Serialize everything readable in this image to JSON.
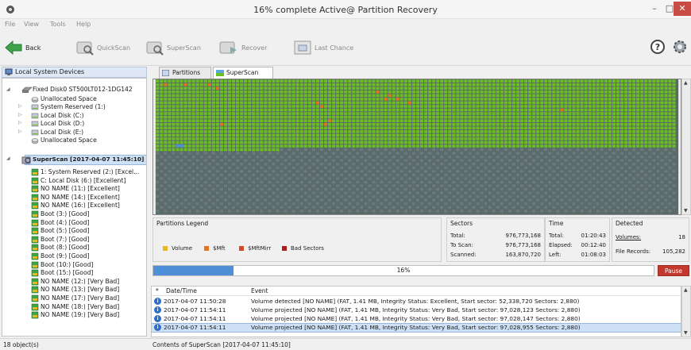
{
  "window": {
    "title": "16% complete Active@ Partition Recovery"
  },
  "menu": [
    "File",
    "View",
    "Tools",
    "Help"
  ],
  "toolbar": {
    "back": "Back",
    "quickscan": "QuickScan",
    "superscan": "SuperScan",
    "recover": "Recover",
    "last_chance": "Last Chance"
  },
  "left_panel": {
    "header": "Local System Devices",
    "disk": "Fixed Disk0 ST500LT012-1DG142",
    "disk_children": [
      "Unallocated Space",
      "System Reserved (1:)",
      "Local Disk (C:)",
      "Local Disk (D:)",
      "Local Disk (E:)",
      "Unallocated Space"
    ],
    "scan": "SuperScan [2017-04-07 11:45:10]",
    "scan_children": [
      "1: System Reserved (2:) [Excel...",
      "C: Local Disk (6:) [Excellent]",
      "NO NAME (11:) [Excellent]",
      "NO NAME (14:) [Excellent]",
      "NO NAME (16:) [Excellent]",
      "Boot (3:) [Good]",
      "Boot (4:) [Good]",
      "Boot (5:) [Good]",
      "Boot (7:) [Good]",
      "Boot (8:) [Good]",
      "Boot (9:) [Good]",
      "Boot (10:) [Good]",
      "Boot (15:) [Good]",
      "NO NAME (12:) [Very Bad]",
      "NO NAME (13:) [Very Bad]",
      "NO NAME (17:) [Very Bad]",
      "NO NAME (18:) [Very Bad]",
      "NO NAME (19:) [Very Bad]"
    ]
  },
  "tabs": [
    "Partitions [18]",
    "SuperScan [16%]"
  ],
  "legend": {
    "title": "Partitions Legend",
    "items": [
      {
        "label": "Volume",
        "color": "#e8b81c"
      },
      {
        "label": "$Mft",
        "color": "#e8731c"
      },
      {
        "label": "$MftMirr",
        "color": "#d24a2a"
      },
      {
        "label": "Bad Sectors",
        "color": "#b01c1c"
      }
    ]
  },
  "sectors": {
    "title": "Sectors",
    "total_label": "Total:",
    "total": "976,773,168",
    "toscan_label": "To Scan:",
    "toscan": "976,773,168",
    "scanned_label": "Scanned:",
    "scanned": "163,870,720"
  },
  "time": {
    "title": "Time",
    "total_label": "Total:",
    "total": "01:20:43",
    "elapsed_label": "Elapsed:",
    "elapsed": "00:12:40",
    "left_label": "Left:",
    "left": "01:08:03"
  },
  "detected": {
    "title": "Detected",
    "volumes_label": "Volumes:",
    "volumes": "18",
    "files_label": "File Records:",
    "files": "105,282"
  },
  "progress": {
    "percent_text": "16%",
    "fraction": 0.16
  },
  "pause": "Pause",
  "log": {
    "col_sort": "*",
    "col_date": "Date/Time",
    "col_event": "Event",
    "rows": [
      {
        "dt": "2017-04-07 11:50:28",
        "ev": "Volume detected [NO NAME] (FAT, 1.41 MB, Integrity Status: Excellent, Start sector: 52,338,720 Sectors: 2,880)"
      },
      {
        "dt": "2017-04-07 11:54:11",
        "ev": "Volume projected [NO NAME] (FAT, 1.41 MB, Integrity Status: Very Bad, Start sector: 97,028,123 Sectors: 2,880)"
      },
      {
        "dt": "2017-04-07 11:54:11",
        "ev": "Volume projected [NO NAME] (FAT, 1.41 MB, Integrity Status: Very Bad, Start sector: 97,028,147 Sectors: 2,880)"
      },
      {
        "dt": "2017-04-07 11:54:11",
        "ev": "Volume projected [NO NAME] (FAT, 1.41 MB, Integrity Status: Very Bad, Start sector: 97,028,955 Sectors: 2,880)"
      }
    ]
  },
  "status": {
    "left": "18 object(s)",
    "right": "Contents of SuperScan [2017-04-07 11:45:10]"
  },
  "colors": {
    "scanned": "#6bbf1f",
    "unscanned": "#5a6a6a",
    "accent": "#4d90d9",
    "pause": "#c23a2e"
  }
}
